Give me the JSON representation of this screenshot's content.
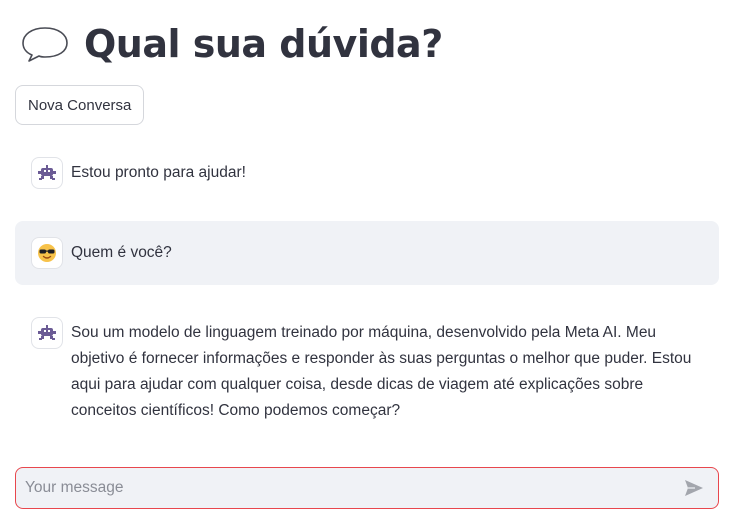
{
  "header": {
    "title": "Qual sua dúvida?",
    "icon": "speech-bubble-icon"
  },
  "toolbar": {
    "new_chat_label": "Nova Conversa"
  },
  "messages": [
    {
      "role": "assistant",
      "avatar": "robot-icon",
      "text": "Estou pronto para ajudar!"
    },
    {
      "role": "user",
      "avatar": "sunglasses-face-icon",
      "text": "Quem é você?"
    },
    {
      "role": "assistant",
      "avatar": "robot-icon",
      "text": "Sou um modelo de linguagem treinado por máquina, desenvolvido pela Meta AI. Meu objetivo é fornecer informações e responder às suas perguntas o melhor que puder. Estou aqui para ajudar com qualquer coisa, desde dicas de viagem até explicações sobre conceitos científicos! Como podemos começar?"
    }
  ],
  "chat_input": {
    "placeholder": "Your message",
    "value": "",
    "send_icon": "send-icon"
  },
  "colors": {
    "text": "#31333f",
    "user_message_bg": "#f0f2f6",
    "input_border": "#e8474d",
    "robot": "#6b5b95",
    "emoji_face": "#f7c24a"
  }
}
